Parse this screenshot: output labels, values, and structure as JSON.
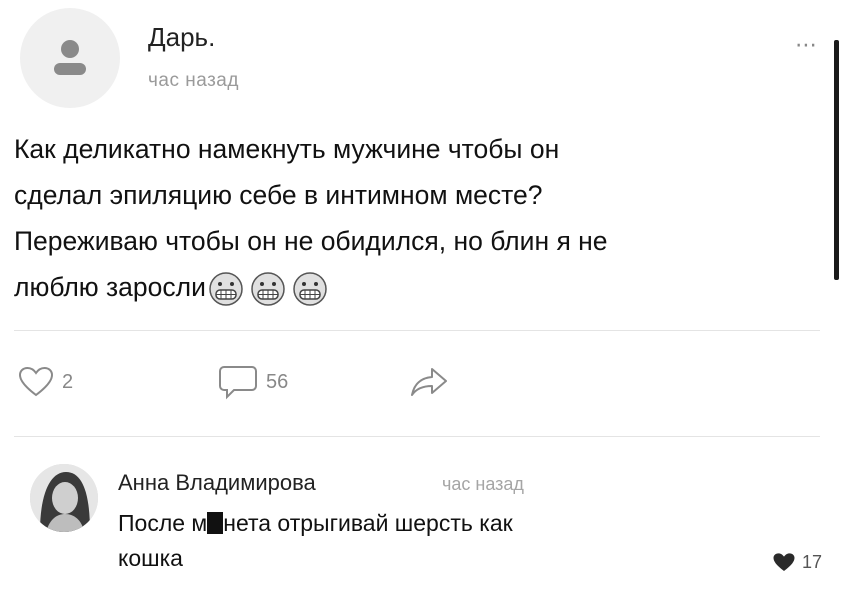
{
  "post": {
    "author": "Дарь.",
    "time": "час назад",
    "text_lines": [
      "Как деликатно намекнуть мужчине чтобы он",
      "сделал эпиляцию себе в интимном месте?",
      "Переживаю чтобы он не обидился, но блин я не",
      "люблю заросли"
    ],
    "emojis": [
      "grimacing-face",
      "grimacing-face",
      "grimacing-face"
    ],
    "more_icon": "⋯"
  },
  "actions": {
    "likes": "2",
    "comments": "56",
    "like_icon": "heart-outline-icon",
    "comment_icon": "comment-bubble-icon",
    "share_icon": "share-arrow-icon"
  },
  "comment": {
    "author": "Анна Владимирова",
    "time": "час назад",
    "text_before": "После м",
    "text_after": "нета отрыгивай шерсть как",
    "text_line2": "кошка",
    "likes": "17",
    "like_icon": "heart-filled-icon"
  },
  "colors": {
    "text": "#111111",
    "muted": "#9a9a9a",
    "divider": "#e4e4e4",
    "avatar_bg": "#f0f0f0"
  }
}
